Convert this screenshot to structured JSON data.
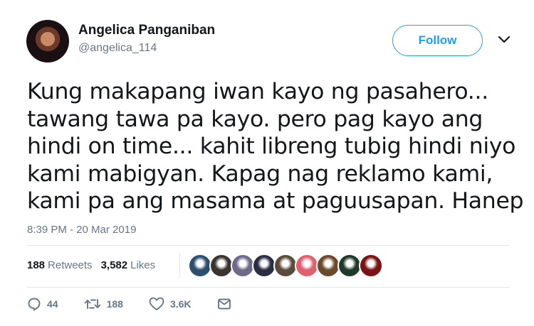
{
  "user": {
    "display_name": "Angelica Panganiban",
    "handle": "@angelica_114"
  },
  "follow_label": "Follow",
  "tweet": {
    "lines": [
      "Kung makapang iwan kayo ng pasahero...",
      "tawang tawa pa kayo. pero pag kayo ang",
      "hindi on time... kahit libreng tubig hindi niyo",
      "kami mabigyan. Kapag nag reklamo kami,",
      "kami pa ang masama at paguusapan. Hanep"
    ],
    "timestamp": "8:39 PM - 20 Mar 2019"
  },
  "stats": {
    "retweets_count": "188",
    "retweets_label": "Retweets",
    "likes_count": "3,582",
    "likes_label": "Likes"
  },
  "likers": [
    {
      "icon": "liker-avatar-1",
      "color": "#2c4f6e"
    },
    {
      "icon": "liker-avatar-2",
      "color": "#3a3330"
    },
    {
      "icon": "liker-avatar-3",
      "color": "#6d6a8a"
    },
    {
      "icon": "liker-avatar-4",
      "color": "#2a2d44"
    },
    {
      "icon": "liker-avatar-5",
      "color": "#5b4b3a"
    },
    {
      "icon": "liker-avatar-6",
      "color": "#e0606e"
    },
    {
      "icon": "liker-avatar-7",
      "color": "#6a4a2a"
    },
    {
      "icon": "liker-avatar-8",
      "color": "#1f3a2a"
    },
    {
      "icon": "liker-avatar-9",
      "color": "#7a1414"
    }
  ],
  "actions": {
    "replies": "44",
    "retweets": "188",
    "likes": "3.6K"
  },
  "colors": {
    "accent": "#1da1f2",
    "secondary_text": "#657786",
    "divider": "#e1e8ed"
  }
}
